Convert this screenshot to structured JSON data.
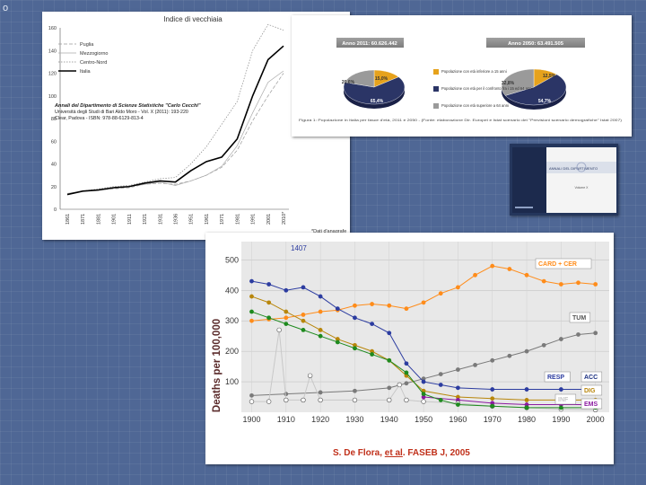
{
  "corner_mark": "o",
  "italy_chart": {
    "title": "Indice di vecchiaia",
    "legend": [
      "Puglia",
      "Mezzogiorno",
      "Centro-Nord",
      "Italia"
    ],
    "citation": [
      "Annali del Dipartimento di Scienze Statistiche \"Carlo Cecchi\"",
      "Università degli Studi di Bari Aldo Moro - Vol. X (2011): 193-220",
      "Clear, Padova - ISBN: 978-88-6129-813-4"
    ],
    "footnote": "*Dati d'anagrafe",
    "y_ticks": [
      "0",
      "20",
      "40",
      "60",
      "80",
      "100",
      "120",
      "140",
      "160"
    ],
    "x_ticks": [
      "1861",
      "1871",
      "1881",
      "1901",
      "1911",
      "1921",
      "1931",
      "1936",
      "1951",
      "1961",
      "1971",
      "1981",
      "1991",
      "2001",
      "2010*"
    ],
    "chart_data": {
      "type": "line",
      "title": "Indice di vecchiaia",
      "categories": [
        "1861",
        "1871",
        "1881",
        "1901",
        "1911",
        "1921",
        "1931",
        "1936",
        "1951",
        "1961",
        "1971",
        "1981",
        "1991",
        "2001",
        "2010*"
      ],
      "ylim": [
        0,
        160
      ],
      "series": [
        {
          "name": "Puglia",
          "values": [
            13,
            16,
            17,
            18,
            19,
            22,
            23,
            22,
            25,
            30,
            37,
            52,
            78,
            100,
            120
          ]
        },
        {
          "name": "Mezzogiorno",
          "values": [
            14,
            16,
            17,
            19,
            20,
            22,
            24,
            21,
            25,
            30,
            38,
            56,
            85,
            112,
            122
          ]
        },
        {
          "name": "Centro-Nord",
          "values": [
            13,
            16,
            18,
            20,
            21,
            24,
            27,
            28,
            40,
            55,
            75,
            95,
            140,
            163,
            158
          ]
        },
        {
          "name": "Italia",
          "values": [
            13,
            16,
            17,
            19,
            20,
            23,
            25,
            24,
            34,
            42,
            46,
            62,
            100,
            132,
            144
          ]
        }
      ]
    }
  },
  "pie_panel": {
    "left_title": "Anno 2011: 60.626.442",
    "right_title": "Anno 2050: 63.491.505",
    "left_labels": [
      "20,6%",
      "15,0%",
      "65,4%"
    ],
    "right_labels": [
      "32,8%",
      "12,5%",
      "54,7%"
    ],
    "legend": [
      "Popolazione con età inferiore a 15 anni",
      "Popolazione con età per il confronto fra i 15 ed 64 anni",
      "Popolazione con età superiore a 64 anni"
    ],
    "caption": "Figura 1: Popolazione in Italia per fasce d'età, 2011 e 2050 - (Fonte: elaborazione Dir. Europei e Istat scenario dei \"Previsioni scenario demografiche\" Istat 2007)",
    "chart_data": [
      {
        "type": "pie",
        "title": "Anno 2011: 60.626.442",
        "categories": [
          "Popolazione con età inferiore a 15 anni",
          "Popolazione con età per il confronto fra i 15 ed 64 anni",
          "Popolazione con età superiore a 64 anni"
        ],
        "values": [
          15.0,
          65.4,
          20.6
        ]
      },
      {
        "type": "pie",
        "title": "Anno 2050: 63.491.505",
        "categories": [
          "Popolazione con età inferiore a 15 anni",
          "Popolazione con età per il confronto fra i 15 ed 64 anni",
          "Popolazione con età superiore a 64 anni"
        ],
        "values": [
          12.5,
          54.7,
          32.8
        ]
      }
    ]
  },
  "journal_cover": {
    "title": "ANNALI DEL DIPARTIMENTO",
    "subtitle": "Volume X"
  },
  "deaths_chart": {
    "ylabel": "Deaths per 100,000",
    "y_ticks": [
      "100",
      "200",
      "300",
      "400",
      "500"
    ],
    "x_ticks": [
      "1900",
      "1910",
      "1920",
      "1930",
      "1940",
      "1950",
      "1960",
      "1970",
      "1980",
      "1990",
      "2000"
    ],
    "peak_label": "1407",
    "citation_parts": {
      "author": "S. De Flora, ",
      "etal": "et al",
      "rest": ". FASEB J, 2005"
    },
    "series_labels": [
      "CARD + CER",
      "TUM",
      "RESP",
      "ACC",
      "DIG",
      "EMS",
      "INF"
    ],
    "colors": {
      "CARD + CER": "#ff8c1a",
      "TUM": "#7a7a7a",
      "RESP": "#2c3ca0",
      "ACC": "#1a2f80",
      "DIG": "#b8860b",
      "EMS": "#8b1aa0",
      "INF": "#c8c8c8",
      "green": "#1e8a1e"
    },
    "chart_data": {
      "type": "scatter",
      "xlabel": "",
      "ylabel": "Deaths per 100,000",
      "xlim": [
        1897,
        2004
      ],
      "ylim": [
        0,
        560
      ],
      "series": [
        {
          "name": "CARD + CER",
          "x": [
            1900,
            1905,
            1910,
            1915,
            1920,
            1925,
            1930,
            1935,
            1940,
            1945,
            1950,
            1955,
            1960,
            1965,
            1970,
            1975,
            1980,
            1985,
            1990,
            1995,
            2000
          ],
          "y": [
            300,
            305,
            310,
            320,
            330,
            335,
            350,
            355,
            350,
            340,
            360,
            390,
            410,
            450,
            480,
            470,
            450,
            430,
            420,
            425,
            420
          ]
        },
        {
          "name": "TUM",
          "x": [
            1900,
            1910,
            1920,
            1930,
            1940,
            1945,
            1950,
            1955,
            1960,
            1965,
            1970,
            1975,
            1980,
            1985,
            1990,
            1995,
            2000
          ],
          "y": [
            55,
            60,
            65,
            70,
            80,
            95,
            110,
            125,
            140,
            155,
            170,
            185,
            200,
            220,
            240,
            255,
            260
          ]
        },
        {
          "name": "RESP",
          "x": [
            1900,
            1905,
            1910,
            1915,
            1920,
            1925,
            1930,
            1935,
            1940,
            1945,
            1950,
            1955,
            1960,
            1970,
            1980,
            1990,
            2000
          ],
          "y": [
            430,
            420,
            400,
            410,
            380,
            340,
            310,
            290,
            260,
            160,
            100,
            90,
            80,
            75,
            75,
            75,
            75
          ]
        },
        {
          "name": "DIG",
          "x": [
            1900,
            1905,
            1910,
            1915,
            1920,
            1925,
            1930,
            1935,
            1940,
            1945,
            1950,
            1960,
            1970,
            1980,
            1990,
            2000
          ],
          "y": [
            380,
            360,
            330,
            300,
            270,
            240,
            220,
            200,
            170,
            120,
            70,
            50,
            45,
            40,
            40,
            40
          ]
        },
        {
          "name": "EMS",
          "x": [
            1950,
            1960,
            1970,
            1980,
            1990,
            2000
          ],
          "y": [
            50,
            40,
            30,
            25,
            25,
            25
          ]
        },
        {
          "name": "INF",
          "x": [
            1900,
            1905,
            1908,
            1910,
            1915,
            1917,
            1920,
            1930,
            1940,
            1943,
            1945,
            1950,
            1960,
            1970,
            1980,
            1990,
            2000
          ],
          "y": [
            35,
            35,
            270,
            40,
            40,
            120,
            40,
            40,
            40,
            90,
            40,
            35,
            30,
            20,
            15,
            10,
            8
          ]
        },
        {
          "name": "",
          "x": [
            1900,
            1905,
            1910,
            1915,
            1920,
            1925,
            1930,
            1935,
            1940,
            1945,
            1950,
            1955,
            1960,
            1970,
            1980,
            1990,
            2000
          ],
          "y": [
            330,
            310,
            290,
            270,
            250,
            230,
            210,
            190,
            170,
            130,
            60,
            40,
            25,
            20,
            15,
            15,
            15
          ]
        }
      ]
    }
  }
}
